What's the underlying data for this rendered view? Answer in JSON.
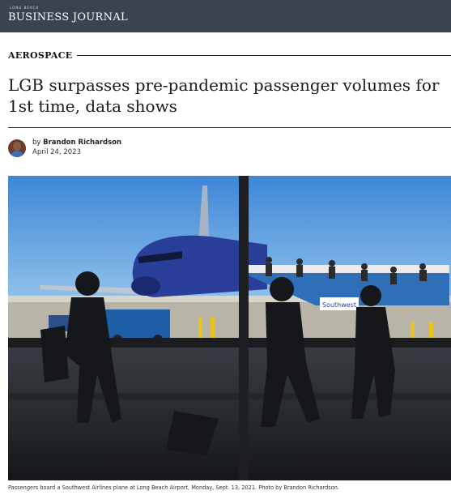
{
  "masthead": {
    "kicker": "LONG BEACH",
    "name": "BUSINESS JOURNAL"
  },
  "article": {
    "section": "AEROSPACE",
    "headline": "LGB surpasses pre-pandemic passenger volumes for 1st time, data shows",
    "byline_prefix": "by",
    "author": "Brandon Richardson",
    "date": "April 24, 2023",
    "photo_caption": "Passengers board a Southwest Airlines plane at Long Beach Airport, Monday, Sept. 13, 2021. Photo by Brandon Richardson.",
    "photo_jetbridge_text": "Southwest"
  },
  "colors": {
    "masthead_bg": "#3a4350",
    "sky": "#4a8fd6",
    "plane_blue": "#2a3f9a"
  }
}
